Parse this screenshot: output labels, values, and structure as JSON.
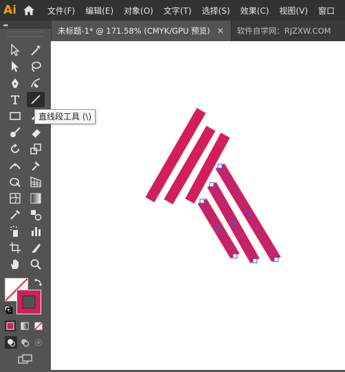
{
  "app": {
    "logo": "Ai"
  },
  "menu": [
    "文件(F)",
    "编辑(E)",
    "对象(O)",
    "文字(T)",
    "选择(S)",
    "效果(C)",
    "视图(V)",
    "窗口"
  ],
  "tabs": {
    "active": "未标题-1* @ 171.58% (CMYK/GPU 预览)",
    "close": "✕",
    "inactive": "软件自学网：RJZXW.COM"
  },
  "toolbar": {
    "collapse": "◂◂",
    "tooltip": "直线段工具 (\\)"
  },
  "colors": {
    "stroke_accent": "#d41e5a",
    "selection": "#3a56e6",
    "ui_dark": "#323232",
    "ui_panel": "#535353"
  },
  "icons": [
    "home-icon",
    "selection-tool-icon",
    "direct-selection-icon",
    "magic-wand-icon",
    "lasso-icon",
    "pen-tool-icon",
    "curvature-tool-icon",
    "type-tool-icon",
    "line-segment-tool-icon",
    "rectangle-tool-icon",
    "paintbrush-tool-icon",
    "shaper-tool-icon",
    "eraser-tool-icon",
    "rotate-tool-icon",
    "scale-tool-icon",
    "width-tool-icon",
    "puppet-warp-icon",
    "shape-builder-icon",
    "perspective-grid-icon",
    "mesh-tool-icon",
    "gradient-tool-icon",
    "eyedropper-tool-icon",
    "blend-tool-icon",
    "symbol-sprayer-icon",
    "column-graph-icon",
    "artboard-tool-icon",
    "slice-tool-icon",
    "hand-tool-icon",
    "zoom-tool-icon",
    "fill-swatch-icon",
    "stroke-swatch-icon",
    "swap-colors-icon",
    "default-colors-icon",
    "color-mode-icon",
    "gradient-mode-icon",
    "none-mode-icon",
    "draw-normal-icon",
    "draw-behind-icon",
    "draw-inside-icon",
    "screen-mode-icon"
  ]
}
